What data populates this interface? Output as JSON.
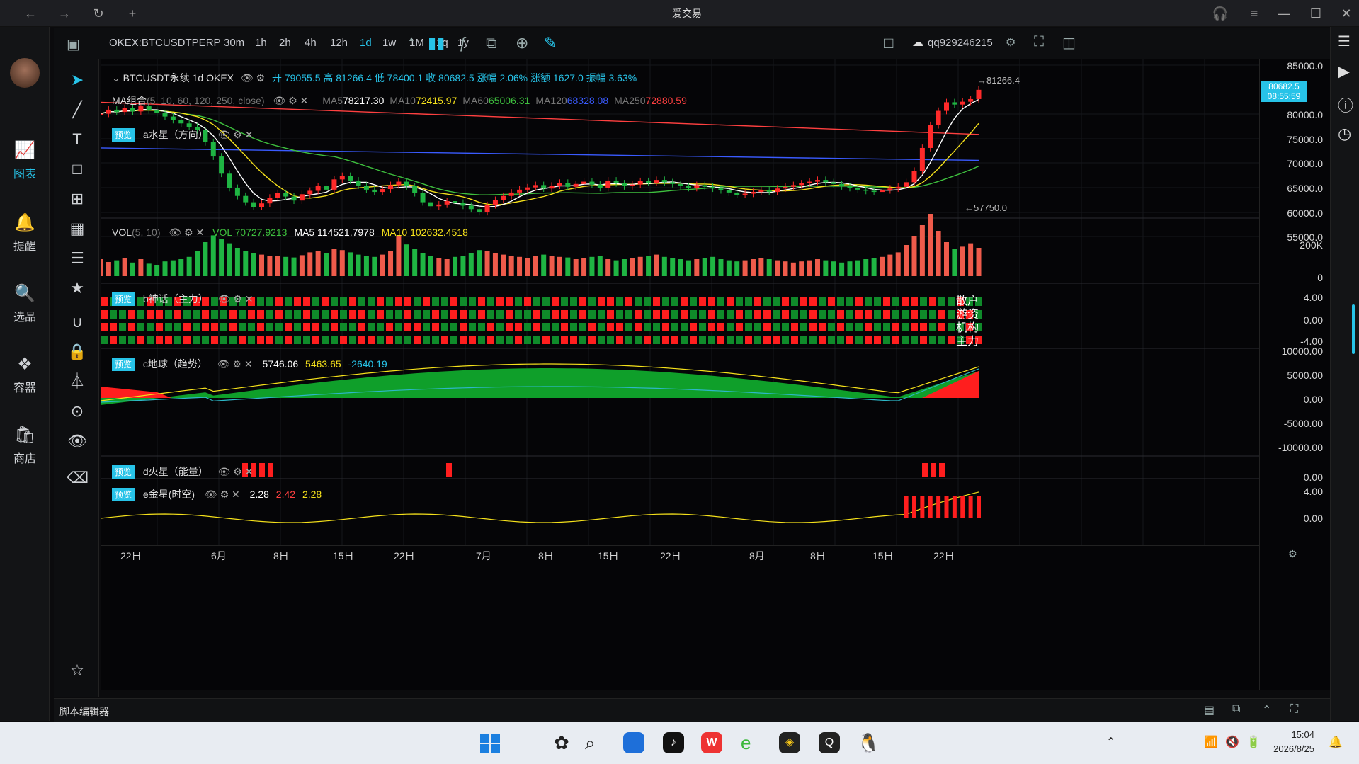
{
  "app": {
    "title": "爱交易",
    "nav_back": "←",
    "nav_forward": "→",
    "nav_reload": "↻",
    "nav_newtab": "+",
    "win_min": "—",
    "win_max": "☐",
    "win_close": "✕"
  },
  "leftnav": [
    {
      "label": "图表",
      "icon": "chart-icon",
      "glyph": "📈",
      "active": true
    },
    {
      "label": "提醒",
      "icon": "bell-icon",
      "glyph": "🔔",
      "active": false
    },
    {
      "label": "选品",
      "icon": "screener-icon",
      "glyph": "🔍",
      "active": false
    },
    {
      "label": "容器",
      "icon": "container-icon",
      "glyph": "❖",
      "active": false
    },
    {
      "label": "商店",
      "icon": "shop-icon",
      "glyph": "🛍",
      "active": false
    }
  ],
  "toolbar": {
    "symbol": "OKEX:BTCUSDTPERP",
    "timeframes": [
      "30m",
      "1h",
      "2h",
      "4h",
      "12h",
      "1d",
      "1w",
      "1M",
      "1q",
      "1y"
    ],
    "active_timeframe": "1d",
    "user": "qq929246215"
  },
  "main_legend": {
    "name": "BTCUSDT永续 1d OKEX",
    "ohlc": "开 79055.5 高 81266.4 低 78400.1 收 80682.5 涨幅 2.06% 涨额 1627.0 振幅 3.63%"
  },
  "ma_legend": {
    "name": "MA组合",
    "params": "(5, 10, 60, 120, 250, close)",
    "values": [
      {
        "label": "MA5",
        "value": "78217.30",
        "color": "#ffffff"
      },
      {
        "label": "MA10",
        "value": "72415.97",
        "color": "#f5e11b"
      },
      {
        "label": "MA60",
        "value": "65006.31",
        "color": "#3ec03e"
      },
      {
        "label": "MA120",
        "value": "68328.08",
        "color": "#3a5bff"
      },
      {
        "label": "MA250",
        "value": "72880.59",
        "color": "#ff4040"
      }
    ]
  },
  "a_indicator": {
    "tag": "预览",
    "name": "a水星（方向）"
  },
  "price_axis": [
    "85000.0",
    "80000.0",
    "75000.0",
    "70000.0",
    "65000.0",
    "60000.0",
    "55000.0"
  ],
  "last_price": "80682.5",
  "countdown": "08:55:59",
  "high_mark": "→81266.4",
  "low_mark": "←57750.0",
  "vol_legend": {
    "name": "VOL",
    "params": "(5, 10)",
    "vol": "VOL 70727.9213",
    "ma5": "MA5 114521.7978",
    "ma10": "MA10 102632.4518"
  },
  "vol_axis": [
    "200K",
    "0"
  ],
  "b_indicator": {
    "tag": "预览",
    "name": "b神话（主力）",
    "row_labels": [
      "散户",
      "游资",
      "机构",
      "主力"
    ]
  },
  "b_axis": [
    "4.00",
    "0.00",
    "-4.00"
  ],
  "c_indicator": {
    "tag": "预览",
    "name": "c地球（趋势）",
    "v1": "5746.06",
    "v2": "5463.65",
    "v3": "-2640.19"
  },
  "c_axis": [
    "10000.00",
    "5000.00",
    "0.00",
    "-5000.00",
    "-10000.00"
  ],
  "d_indicator": {
    "tag": "预览",
    "name": "d火星（能量）"
  },
  "d_axis": [
    "0.00"
  ],
  "e_indicator": {
    "tag": "预览",
    "name": "e金星(时空)",
    "v1": "2.28",
    "v2": "2.42",
    "v3": "2.28"
  },
  "e_axis": [
    "4.00",
    "0.00"
  ],
  "dates": [
    "22日",
    "6月",
    "8日",
    "15日",
    "22日",
    "7月",
    "8日",
    "15日",
    "22日",
    "8月",
    "8日",
    "15日",
    "22日"
  ],
  "script_editor": "脚本编辑器",
  "taskbar": {
    "time": "15:04",
    "date": "2026/8/25"
  },
  "chart_data": {
    "type": "candlestick",
    "ylim": [
      55000,
      85000
    ],
    "x": [
      "5/22",
      "5/23",
      "5/24",
      "5/25",
      "5/26",
      "5/27",
      "5/28",
      "5/29",
      "5/30",
      "5/31",
      "6/1",
      "6/2",
      "6/3",
      "6/4",
      "6/5",
      "6/6",
      "6/7",
      "6/8",
      "6/9",
      "6/10",
      "6/11",
      "6/12",
      "6/13",
      "6/14",
      "6/15",
      "6/16",
      "6/17",
      "6/18",
      "6/19",
      "6/20",
      "6/21",
      "6/22",
      "6/23",
      "6/24",
      "6/25",
      "6/26",
      "6/27",
      "6/28",
      "6/29",
      "6/30",
      "7/1",
      "7/2",
      "7/3",
      "7/4",
      "7/5",
      "7/6",
      "7/7",
      "7/8",
      "7/9",
      "7/10",
      "7/11",
      "7/12",
      "7/13",
      "7/14",
      "7/15",
      "7/16",
      "7/17",
      "7/18",
      "7/19",
      "7/20",
      "7/21",
      "7/22",
      "7/23",
      "7/24",
      "7/25",
      "7/26",
      "7/27",
      "7/28",
      "7/29",
      "7/30",
      "7/31",
      "8/1",
      "8/2",
      "8/3",
      "8/4",
      "8/5",
      "8/6",
      "8/7",
      "8/8",
      "8/9",
      "8/10",
      "8/11",
      "8/12",
      "8/13",
      "8/14",
      "8/15",
      "8/16",
      "8/17",
      "8/18",
      "8/19",
      "8/20",
      "8/21",
      "8/22",
      "8/23",
      "8/24",
      "8/25",
      "8/26",
      "8/27",
      "8/28",
      "8/29",
      "8/30",
      "8/31",
      "9/1",
      "9/2",
      "9/3",
      "9/4",
      "9/5",
      "9/6",
      "9/7",
      "9/8",
      "9/9",
      "9/10",
      "9/11",
      "9/12",
      "9/13",
      "9/14",
      "9/15",
      "9/16",
      "9/17",
      "9/18",
      "9/19",
      "9/20"
    ],
    "close": [
      76500,
      77200,
      76800,
      77500,
      76900,
      77800,
      77100,
      76600,
      76000,
      75400,
      74800,
      74200,
      73600,
      71500,
      69000,
      66000,
      63500,
      62100,
      61000,
      60200,
      60800,
      61800,
      62600,
      62000,
      61300,
      62400,
      63000,
      63800,
      63200,
      65000,
      65600,
      64800,
      63900,
      63200,
      62800,
      63300,
      64000,
      64600,
      63800,
      62600,
      61000,
      60300,
      60600,
      61200,
      60900,
      60400,
      59800,
      59300,
      60500,
      61400,
      62100,
      62700,
      63200,
      63600,
      64000,
      63400,
      63900,
      64400,
      63700,
      64200,
      64600,
      64100,
      63500,
      64800,
      64300,
      63800,
      64100,
      64700,
      64400,
      64900,
      64500,
      64200,
      63800,
      63500,
      64000,
      63700,
      63400,
      63100,
      62700,
      62300,
      62500,
      62800,
      63100,
      62800,
      63400,
      63700,
      64000,
      64300,
      64600,
      64900,
      64500,
      64200,
      63800,
      63500,
      63200,
      63000,
      62800,
      63100,
      63400,
      63700,
      64500,
      66500,
      70500,
      74500,
      77000,
      78500,
      78100,
      78600,
      79055,
      80682
    ],
    "volume": [
      30,
      25,
      28,
      32,
      24,
      30,
      22,
      20,
      26,
      28,
      30,
      34,
      45,
      60,
      72,
      65,
      58,
      50,
      44,
      40,
      38,
      36,
      35,
      34,
      33,
      37,
      42,
      45,
      40,
      48,
      46,
      42,
      38,
      36,
      34,
      38,
      44,
      70,
      56,
      48,
      40,
      35,
      32,
      30,
      34,
      36,
      40,
      46,
      44,
      40,
      38,
      36,
      34,
      32,
      35,
      38,
      36,
      34,
      33,
      30,
      32,
      34,
      36,
      30,
      28,
      30,
      32,
      34,
      36,
      38,
      34,
      32,
      30,
      28,
      30,
      32,
      34,
      30,
      28,
      26,
      28,
      30,
      32,
      30,
      28,
      26,
      24,
      26,
      28,
      30,
      28,
      26,
      24,
      26,
      28,
      30,
      32,
      34,
      38,
      42,
      55,
      70,
      90,
      110,
      80,
      60,
      48,
      52,
      58,
      50
    ]
  }
}
